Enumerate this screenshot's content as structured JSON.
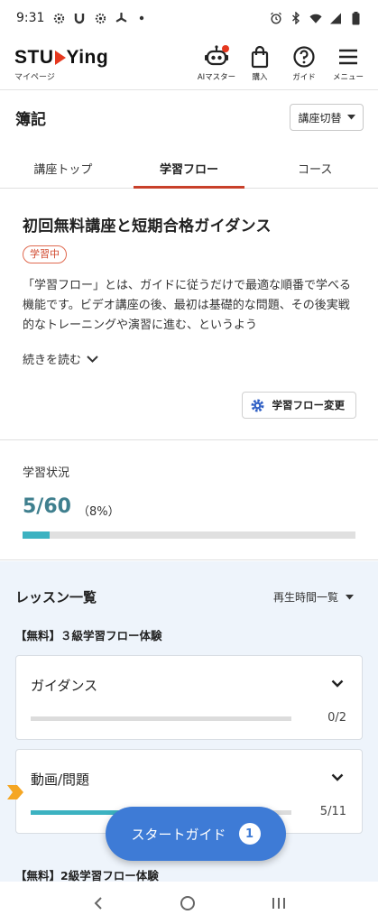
{
  "status_bar": {
    "time": "9:31",
    "left_icons": [
      "gear-icon",
      "magnet-icon",
      "gear-icon",
      "fan-icon",
      "dot-icon"
    ],
    "right_icons": [
      "alarm-icon",
      "bluetooth-icon",
      "wifi-icon",
      "signal-icon",
      "battery-icon"
    ]
  },
  "header": {
    "logo_before": "STU",
    "logo_after": "Ying",
    "logo_sub": "マイページ",
    "buttons": [
      {
        "icon": "robot-icon",
        "label": "AIマスター",
        "notification_dot": true
      },
      {
        "icon": "shopping-bag-icon",
        "label": "購入"
      },
      {
        "icon": "help-icon",
        "label": "ガイド"
      },
      {
        "icon": "menu-icon",
        "label": "メニュー"
      }
    ]
  },
  "course": {
    "title": "簿記",
    "switch_label": "講座切替",
    "tabs": [
      {
        "label": "講座トップ",
        "active": false
      },
      {
        "label": "学習フロー",
        "active": true
      },
      {
        "label": "コース",
        "active": false
      }
    ]
  },
  "flow": {
    "title": "初回無料講座と短期合格ガイダンス",
    "badge": "学習中",
    "description": "「学習フロー」とは、ガイドに従うだけで最適な順番で学べる機能です。ビデオ講座の後、最初は基礎的な問題、その後実戦的なトレーニングや演習に進む、というよう",
    "read_more": "続きを読む",
    "change_button": "学習フロー変更"
  },
  "progress": {
    "label": "学習状況",
    "count": "5/60",
    "percent": "（8%）",
    "fraction": 0.08
  },
  "lessons": {
    "title": "レッスン一覧",
    "sort_label": "再生時間一覧",
    "groups": [
      {
        "title": "【無料】３級学習フロー体験",
        "cards": [
          {
            "title": "ガイダンス",
            "count": "0/2",
            "fraction": 0.0
          },
          {
            "title": "動画/問題",
            "count": "5/11",
            "fraction": 0.45
          }
        ]
      },
      {
        "title": "【無料】2級学習フロー体験"
      }
    ]
  },
  "fab": {
    "label": "スタートガイド",
    "count": "1"
  },
  "colors": {
    "accent_red": "#c8402a",
    "teal": "#3cb2c1",
    "progress_text": "#3f7f8e",
    "fab_blue": "#3e7bd6",
    "lesson_bg": "#eef4fb",
    "marker": "#f5a623"
  }
}
